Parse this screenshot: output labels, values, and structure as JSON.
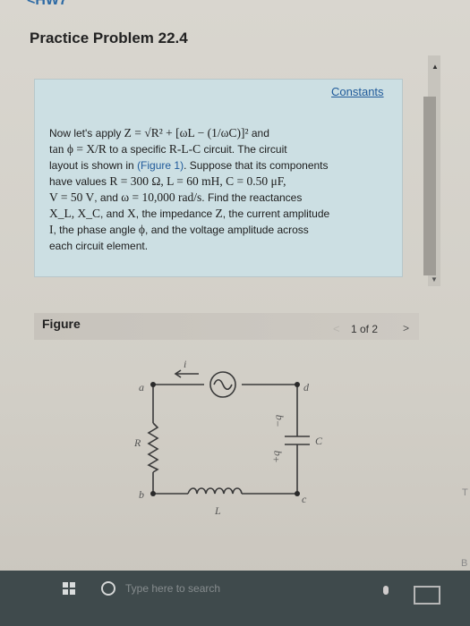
{
  "header": {
    "back_link": "<HW7"
  },
  "problem": {
    "title": "Practice Problem 22.4",
    "constants_link": "Constants",
    "text": {
      "l1a": "Now let's apply ",
      "l1m": "Z = √R² + [ωL − (1/ωC)]²",
      "l1b": " and",
      "l2m": "tan ϕ = X/R",
      "l2a": " to a specific ",
      "l2m2": "R-L-C",
      "l2b": " circuit. The circuit",
      "l3a": "layout is shown in ",
      "l3link": "(Figure 1)",
      "l3b": ". Suppose that its components",
      "l4a": "have values ",
      "l4m": "R = 300 Ω, L = 60 mH, C = 0.50 μF,",
      "l5m": "V = 50 V",
      "l5a": ", and ",
      "l5m2": "ω = 10,000 rad/s",
      "l5b": ". Find the reactances",
      "l6m": "X_L, X_C",
      "l6a": ", and ",
      "l6m2": "X",
      "l6b": ", the impedance ",
      "l6m3": "Z",
      "l6c": ", the current amplitude",
      "l7m": "I",
      "l7a": ", the phase angle ",
      "l7m2": "ϕ",
      "l7b": ", and the voltage amplitude across",
      "l8": "each circuit element."
    }
  },
  "figure": {
    "label": "Figure",
    "pagination": "1 of 2",
    "prev": "<",
    "next": ">",
    "circuit": {
      "current": "i",
      "node_a": "a",
      "node_b": "b",
      "node_c": "c",
      "node_d": "d",
      "resistor": "R",
      "inductor": "L",
      "capacitor": "C",
      "charge_pos": "+q",
      "charge_neg": "−q"
    }
  },
  "taskbar": {
    "search_placeholder": "Type here to search"
  },
  "edge": {
    "t": "T",
    "b": "B"
  },
  "colors": {
    "panel": "#ccdfe3",
    "link": "#1f5a9a",
    "taskbar": "#3f4a4c"
  }
}
